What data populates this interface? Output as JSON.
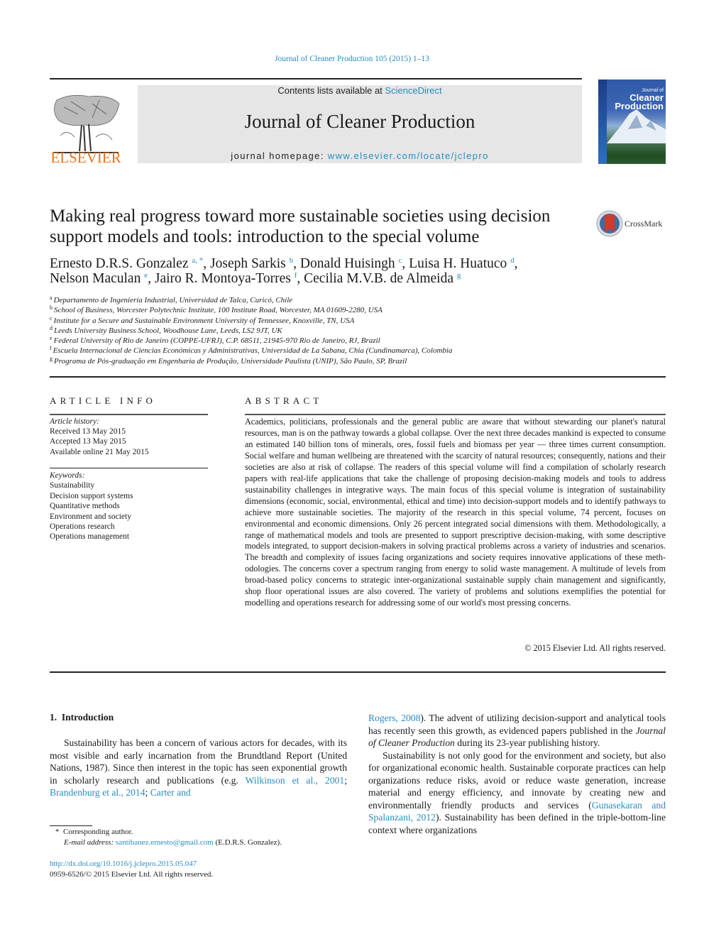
{
  "running_head": "Journal of Cleaner Production 105 (2015) 1–13",
  "header": {
    "publisher_wordmark": "ELSEVIER",
    "contents_prefix": "Contents lists available at ",
    "contents_link": "ScienceDirect",
    "journal_name": "Journal of Cleaner Production",
    "homepage_prefix": "journal homepage: ",
    "homepage_link": "www.elsevier.com/locate/jclepro",
    "cover_title_line1": "Journal of",
    "cover_title_line2": "Cleaner",
    "cover_title_line3": "Production",
    "colors": {
      "link": "#2a8bc0",
      "elsevier_orange": "#e8731c",
      "banner_bg": "#e6e6e6"
    }
  },
  "title": {
    "text": "Making real progress toward more sustainable societies using decision support models and tools: introduction to the special volume",
    "crossmark_label": "CrossMark"
  },
  "authors": [
    {
      "name": "Ernesto D.R.S. Gonzalez",
      "sup": "a, *",
      "sep": ", "
    },
    {
      "name": "Joseph Sarkis",
      "sup": "b",
      "sep": ", "
    },
    {
      "name": "Donald Huisingh",
      "sup": "c",
      "sep": ", "
    },
    {
      "name": "Luisa H. Huatuco",
      "sup": "d",
      "sep": ","
    },
    {
      "name": "Nelson Maculan",
      "sup": "e",
      "sep": ", "
    },
    {
      "name": "Jairo R. Montoya-Torres",
      "sup": "f",
      "sep": ", "
    },
    {
      "name": "Cecilia M.V.B. de Almeida",
      "sup": "g",
      "sep": ""
    }
  ],
  "affiliations": [
    {
      "key": "a",
      "text": "Departamento de Ingeniería Industrial, Universidad de Talca, Curicó, Chile"
    },
    {
      "key": "b",
      "text": "School of Business, Worcester Polytechnic Institute, 100 Institute Road, Worcester, MA 01609-2280, USA"
    },
    {
      "key": "c",
      "text": "Institute for a Secure and Sustainable Environment University of Tennessee, Knoxville, TN, USA"
    },
    {
      "key": "d",
      "text": "Leeds University Business School, Woodhouse Lane, Leeds, LS2 9JT, UK"
    },
    {
      "key": "e",
      "text": "Federal University of Rio de Janeiro (COPPE-UFRJ), C.P. 68511, 21945-970 Rio de Janeiro, RJ, Brazil"
    },
    {
      "key": "f",
      "text": "Escuela Internacional de Ciencias Económicas y Administrativas, Universidad de La Sabana, Chia (Cundinamarca), Colombia"
    },
    {
      "key": "g",
      "text": "Programa de Pós-graduação em Engenharia de Produção, Universidade Paulista (UNIP), São Paulo, SP, Brazil"
    }
  ],
  "article_info": {
    "heading": "ARTICLE INFO",
    "history_label": "Article history:",
    "history": [
      "Received 13 May 2015",
      "Accepted 13 May 2015",
      "Available online 21 May 2015"
    ],
    "keywords_label": "Keywords:",
    "keywords": [
      "Sustainability",
      "Decision support systems",
      "Quantitative methods",
      "Environment and society",
      "Operations research",
      "Operations management"
    ]
  },
  "abstract": {
    "heading": "ABSTRACT",
    "text": "Academics, politicians, professionals and the general public are aware that without stewarding our planet's natural resources, man is on the pathway towards a global collapse. Over the next three decades mankind is expected to consume an estimated 140 billion tons of minerals, ores, fossil fuels and biomass per year — three times current consumption. Social welfare and human wellbeing are threatened with the scarcity of natural resources; consequently, nations and their societies are also at risk of collapse. The readers of this special volume will find a compilation of scholarly research papers with real-life appli­cations that take the challenge of proposing decision-making models and tools to address sustainability challenges in integrative ways. The main focus of this special volume is integration of sustainability dimensions (economic, social, environmental, ethical and time) into decision-support models and to identify pathways to achieve more sustainable societies. The majority of the research in this special volume, 74 percent, focuses on environmental and economic dimensions. Only 26 percent integrated social dimensions with them. Methodologically, a range of mathematical models and tools are presented to support prescriptive decision-making, with some descriptive models integrated, to support decision-makers in solving practical problems across a variety of industries and scenarios. The breadth and complexity of issues facing organizations and society requires innovative applications of these meth­odologies. The concerns cover a spectrum ranging from energy to solid waste management. A multitude of levels from broad-based policy concerns to strategic inter-organizational sustainable supply chain management and significantly, shop floor operational issues are also covered. The variety of problems and solutions exemplifies the potential for modelling and operations research for addressing some of our world's most pressing concerns.",
    "copyright": "© 2015 Elsevier Ltd. All rights reserved."
  },
  "introduction": {
    "heading": "1.  Introduction",
    "col1_p1_start": "Sustainability has been a concern of various actors for decades, with its most visible and early incarnation from the Brundtland Report (United Nations, 1987). Since then interest in the topic has seen exponential growth in scholarly research and publications (e.g. ",
    "col1_cite1": "Wilkinson et al., 2001",
    "col1_sep1": "; ",
    "col1_cite2": "Brandenburg et al., 2014",
    "col1_sep2": "; ",
    "col1_cite3": "Carter and",
    "col2_cite3_cont": "Rogers, 2008",
    "col2_p1_rest_a": "). The advent of utilizing decision-support and analytical tools has recently seen this growth, as evidenced papers published in the ",
    "col2_p1_journal": "Journal of Cleaner Production",
    "col2_p1_rest_b": " during its 23-year publishing history.",
    "col2_p2_a": "Sustainability is not only good for the environment and society, but also for organizational economic health. Sustainable corporate practices can help organizations reduce risks, avoid or reduce waste generation, increase material and energy efficiency, and innovate by creating new and environmentally friendly products and ser­vices (",
    "col2_p2_cite": "Gunasekaran and Spalanzani, 2012",
    "col2_p2_b": "). Sustainability has been defined in the triple-bottom-line context where organizations"
  },
  "footnote": {
    "marker": "*",
    "corresponding": "Corresponding author.",
    "email_label": "E-mail address:",
    "email": "santibanez.ernesto@gmail.com",
    "email_owner": "(E.D.R.S. Gonzalez)."
  },
  "doi": {
    "url": "http://dx.doi.org/10.1016/j.jclepro.2015.05.047",
    "issn_line": "0959-6526/© 2015 Elsevier Ltd. All rights reserved."
  }
}
